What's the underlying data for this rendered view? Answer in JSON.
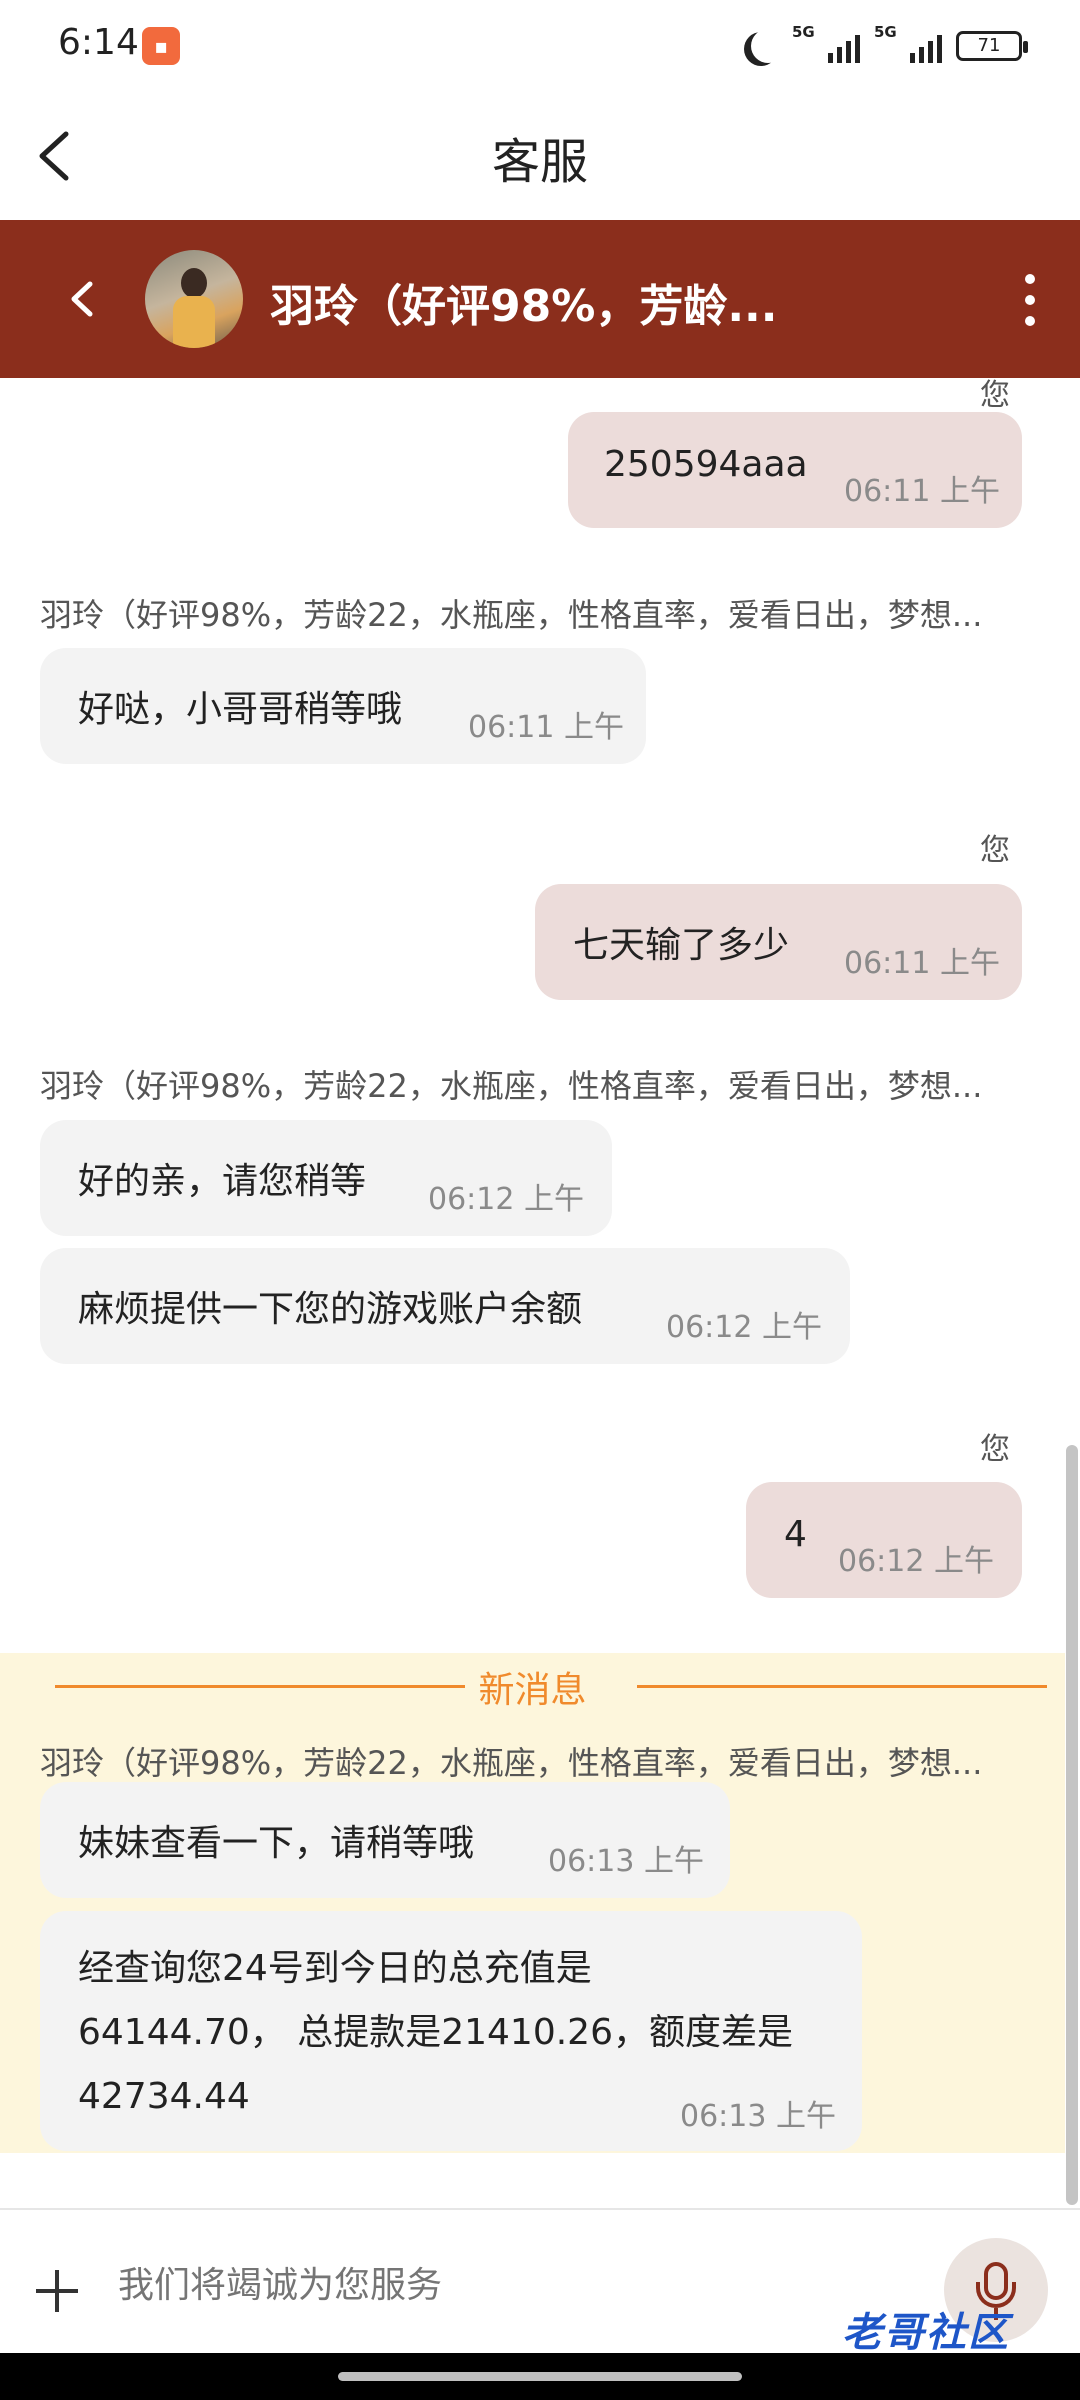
{
  "status_bar": {
    "time": "6:14",
    "signal1_label": "5G",
    "signal2_label": "5G",
    "battery": "71"
  },
  "title_bar": {
    "title": "客服"
  },
  "chat_header": {
    "name": "羽玲（好评98%，芳龄..."
  },
  "messages": {
    "top_you_label": "您",
    "m1": {
      "text": "250594aaa",
      "time": "06:11 上午"
    },
    "sender1": "羽玲（好评98%，芳龄22，水瓶座，性格直率，爱看日出，梦想...",
    "m2": {
      "text": "好哒，小哥哥稍等哦",
      "time": "06:11 上午"
    },
    "you_label1": "您",
    "m3": {
      "text": "七天输了多少",
      "time": "06:11 上午"
    },
    "sender2": "羽玲（好评98%，芳龄22，水瓶座，性格直率，爱看日出，梦想...",
    "m4": {
      "text": "好的亲，请您稍等",
      "time": "06:12 上午"
    },
    "m5": {
      "text": "麻烦提供一下您的游戏账户余额",
      "time": "06:12 上午"
    },
    "you_label2": "您",
    "m6": {
      "text": "4",
      "time": "06:12 上午"
    },
    "new_messages_label": "新消息",
    "sender3": "羽玲（好评98%，芳龄22，水瓶座，性格直率，爱看日出，梦想...",
    "m7": {
      "text": "妹妹查看一下，请稍等哦",
      "time": "06:13 上午"
    },
    "m8": {
      "line1": "经查询您24号到今日的总充值是",
      "line2": "64144.70， 总提款是21410.26，额度差是",
      "line3": "42734.44",
      "time": "06:13 上午"
    }
  },
  "input_bar": {
    "placeholder": "我们将竭诚为您服务"
  },
  "watermark": "老哥社区",
  "icons": [
    "moon-icon",
    "signal-icon",
    "battery-icon",
    "back-icon",
    "more-icon",
    "plus-icon",
    "mic-icon"
  ],
  "colors": {
    "header_bg": "#8b2e1c",
    "outgoing_bubble": "#ecdcda",
    "incoming_bubble": "#f3f3f3",
    "new_message_accent": "#f08a2c",
    "new_message_bg": "#fdf6dc"
  }
}
